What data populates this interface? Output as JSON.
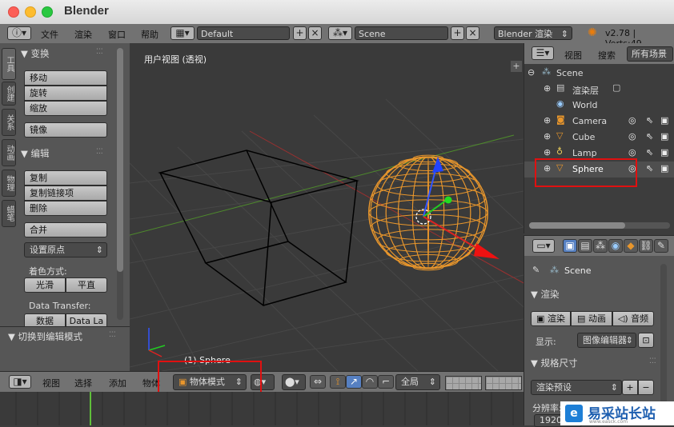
{
  "window": {
    "title": "Blender"
  },
  "info_bar": {
    "menus": [
      "文件",
      "渲染",
      "窗口",
      "帮助"
    ],
    "screen_layout": "Default",
    "scene": "Scene",
    "render_engine": "Blender 渲染",
    "version_info": "v2.78 | Verts:49"
  },
  "tool_shelf": {
    "vertical_tabs": [
      "工具",
      "创建",
      "关系",
      "动画",
      "物理",
      "蜡笔"
    ],
    "transform_header": "变换",
    "transform_buttons": [
      "移动",
      "旋转",
      "缩放"
    ],
    "mirror_button": "镜像",
    "edit_header": "编辑",
    "edit_buttons": [
      "复制",
      "复制链接项",
      "删除"
    ],
    "join_button": "合并",
    "set_origin": "设置原点",
    "shading_label": "着色方式:",
    "shading_buttons": [
      "光滑",
      "平直"
    ],
    "data_transfer_label": "Data Transfer:",
    "data_transfer_buttons": [
      "数据",
      "Data La"
    ],
    "operator_title": "切换到编辑模式"
  },
  "viewport": {
    "view_label": "用户视图 (透视)",
    "object_label": "(1) Sphere",
    "sphere_color": "#e8962c"
  },
  "viewport_header": {
    "menus": [
      "视图",
      "选择",
      "添加",
      "物体"
    ],
    "mode": "物体模式",
    "pivot": "全局"
  },
  "outliner": {
    "menus": [
      "视图",
      "搜索"
    ],
    "filter": "所有场景",
    "items": [
      "Scene",
      "渲染层",
      "World",
      "Camera",
      "Cube",
      "Lamp",
      "Sphere"
    ]
  },
  "properties": {
    "scene_label": "Scene",
    "render_panel": "渲染",
    "render_buttons": [
      "渲染",
      "动画",
      "音频"
    ],
    "display_label": "显示:",
    "display_value": "图像编辑器",
    "dimensions_panel": "规格尺寸",
    "render_preset": "渲染预设",
    "resolution_label": "分辨率:",
    "resolution_x": "1920"
  },
  "watermark": {
    "text": "易采站长站",
    "sub": "www.easck.com"
  }
}
